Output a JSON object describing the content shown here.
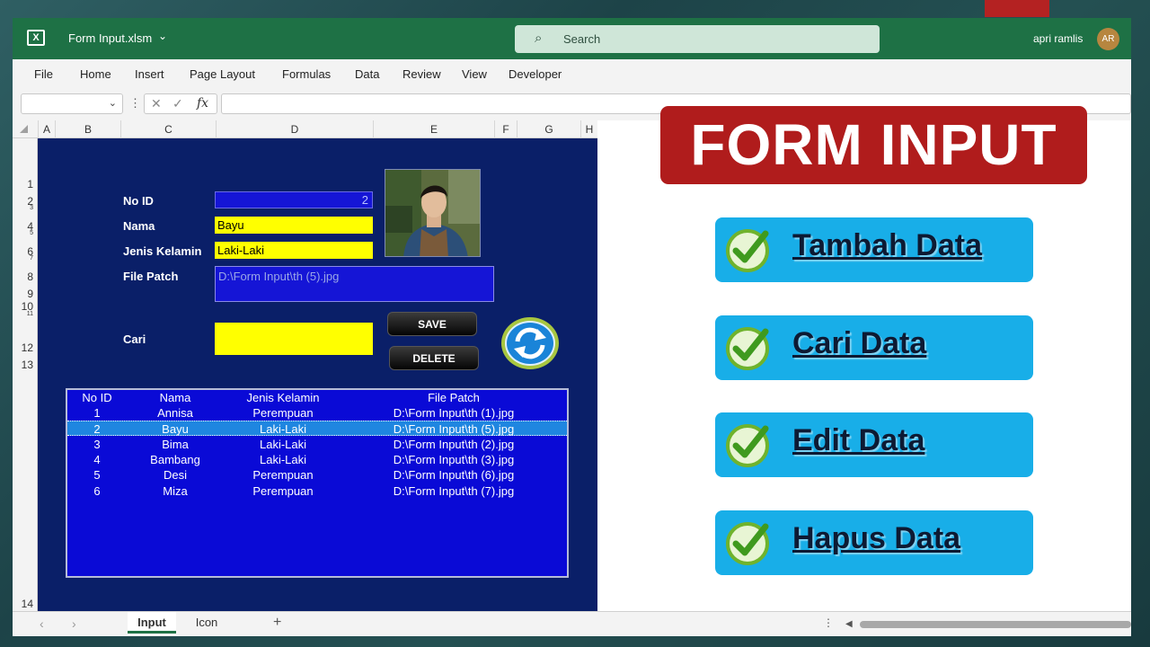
{
  "window": {
    "file_name": "Form Input.xlsm",
    "search_placeholder": "Search",
    "user_name": "apri ramlis",
    "user_initials": "AR"
  },
  "menu": [
    "File",
    "Home",
    "Insert",
    "Page Layout",
    "Formulas",
    "Data",
    "Review",
    "View",
    "Developer"
  ],
  "formula_bar": {
    "fx_label": "fx"
  },
  "columns": [
    "A",
    "B",
    "C",
    "D",
    "E",
    "F",
    "G",
    "H"
  ],
  "rows": [
    "1",
    "2",
    "3",
    "4",
    "5",
    "6",
    "7",
    "8",
    "9",
    "10",
    "11",
    "12",
    "13",
    "14"
  ],
  "form": {
    "no_id_label": "No ID",
    "no_id_value": "2",
    "nama_label": "Nama",
    "nama_value": "Bayu",
    "jk_label": "Jenis Kelamin",
    "jk_value": "Laki-Laki",
    "file_label": "File Patch",
    "file_value": "D:\\Form Input\\th (5).jpg",
    "cari_label": "Cari",
    "save_label": "SAVE",
    "delete_label": "DELETE"
  },
  "listbox": {
    "headers": [
      "No ID",
      "Nama",
      "Jenis Kelamin",
      "File Patch"
    ],
    "selected_index": 1,
    "rows": [
      [
        "1",
        "Annisa",
        "Perempuan",
        "D:\\Form Input\\th (1).jpg"
      ],
      [
        "2",
        "Bayu",
        "Laki-Laki",
        "D:\\Form Input\\th (5).jpg"
      ],
      [
        "3",
        "Bima",
        "Laki-Laki",
        "D:\\Form Input\\th (2).jpg"
      ],
      [
        "4",
        "Bambang",
        "Laki-Laki",
        "D:\\Form Input\\th (3).jpg"
      ],
      [
        "5",
        "Desi",
        "Perempuan",
        "D:\\Form Input\\th (6).jpg"
      ],
      [
        "6",
        "Miza",
        "Perempuan",
        "D:\\Form Input\\th (7).jpg"
      ]
    ]
  },
  "sheets": [
    "Input",
    "Icon"
  ],
  "active_sheet": "Input",
  "banner": "FORM INPUT",
  "features": [
    "Tambah Data",
    "Cari Data",
    "Edit Data",
    "Hapus Data"
  ],
  "colors": {
    "excel_green": "#1e7145",
    "sheet_bg": "#0a1f68",
    "field_blue": "#1515d6",
    "field_yellow": "#ffff00",
    "banner_red": "#b01c1c",
    "feature_blue": "#18aee8"
  }
}
